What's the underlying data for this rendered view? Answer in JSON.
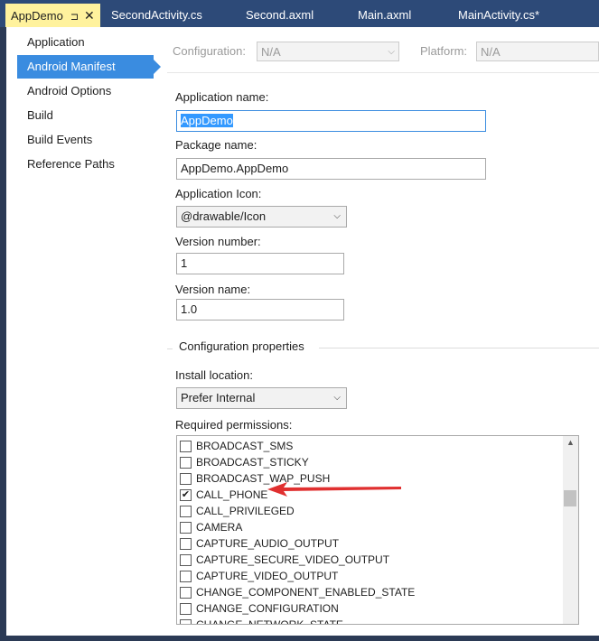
{
  "tabs": [
    {
      "label": "AppDemo",
      "pin": "⊐",
      "close": "✕",
      "active": true
    },
    {
      "label": "SecondActivity.cs"
    },
    {
      "label": "Second.axml"
    },
    {
      "label": "Main.axml"
    },
    {
      "label": "MainActivity.cs*"
    }
  ],
  "sidebar": {
    "items": [
      {
        "label": "Application"
      },
      {
        "label": "Android Manifest",
        "selected": true
      },
      {
        "label": "Android Options"
      },
      {
        "label": "Build"
      },
      {
        "label": "Build Events"
      },
      {
        "label": "Reference Paths"
      }
    ]
  },
  "toolbar": {
    "configuration_label": "Configuration:",
    "configuration_value": "N/A",
    "platform_label": "Platform:",
    "platform_value": "N/A"
  },
  "form": {
    "app_name_label": "Application name:",
    "app_name_value": "AppDemo",
    "package_label": "Package name:",
    "package_value": "AppDemo.AppDemo",
    "icon_label": "Application Icon:",
    "icon_value": "@drawable/Icon",
    "version_number_label": "Version number:",
    "version_number_value": "1",
    "version_name_label": "Version name:",
    "version_name_value": "1.0",
    "config_group_title": "Configuration properties",
    "install_label": "Install location:",
    "install_value": "Prefer Internal",
    "permissions_label": "Required permissions:"
  },
  "permissions": [
    {
      "name": "BROADCAST_SMS",
      "checked": false
    },
    {
      "name": "BROADCAST_STICKY",
      "checked": false
    },
    {
      "name": "BROADCAST_WAP_PUSH",
      "checked": false
    },
    {
      "name": "CALL_PHONE",
      "checked": true
    },
    {
      "name": "CALL_PRIVILEGED",
      "checked": false
    },
    {
      "name": "CAMERA",
      "checked": false
    },
    {
      "name": "CAPTURE_AUDIO_OUTPUT",
      "checked": false
    },
    {
      "name": "CAPTURE_SECURE_VIDEO_OUTPUT",
      "checked": false
    },
    {
      "name": "CAPTURE_VIDEO_OUTPUT",
      "checked": false
    },
    {
      "name": "CHANGE_COMPONENT_ENABLED_STATE",
      "checked": false
    },
    {
      "name": "CHANGE_CONFIGURATION",
      "checked": false
    },
    {
      "name": "CHANGE_NETWORK_STATE",
      "checked": false
    }
  ],
  "icons": {
    "pin": "pin-icon",
    "close": "close-icon",
    "dropdown": "chevron-down-icon",
    "scroll_up": "chevron-up-icon",
    "check": "checkmark-icon",
    "annotation": "red-arrow-annotation"
  },
  "colors": {
    "tabbar": "#2d4a78",
    "active_tab": "#fff29d",
    "selection": "#3a8ce0",
    "annotation": "#e03030"
  }
}
